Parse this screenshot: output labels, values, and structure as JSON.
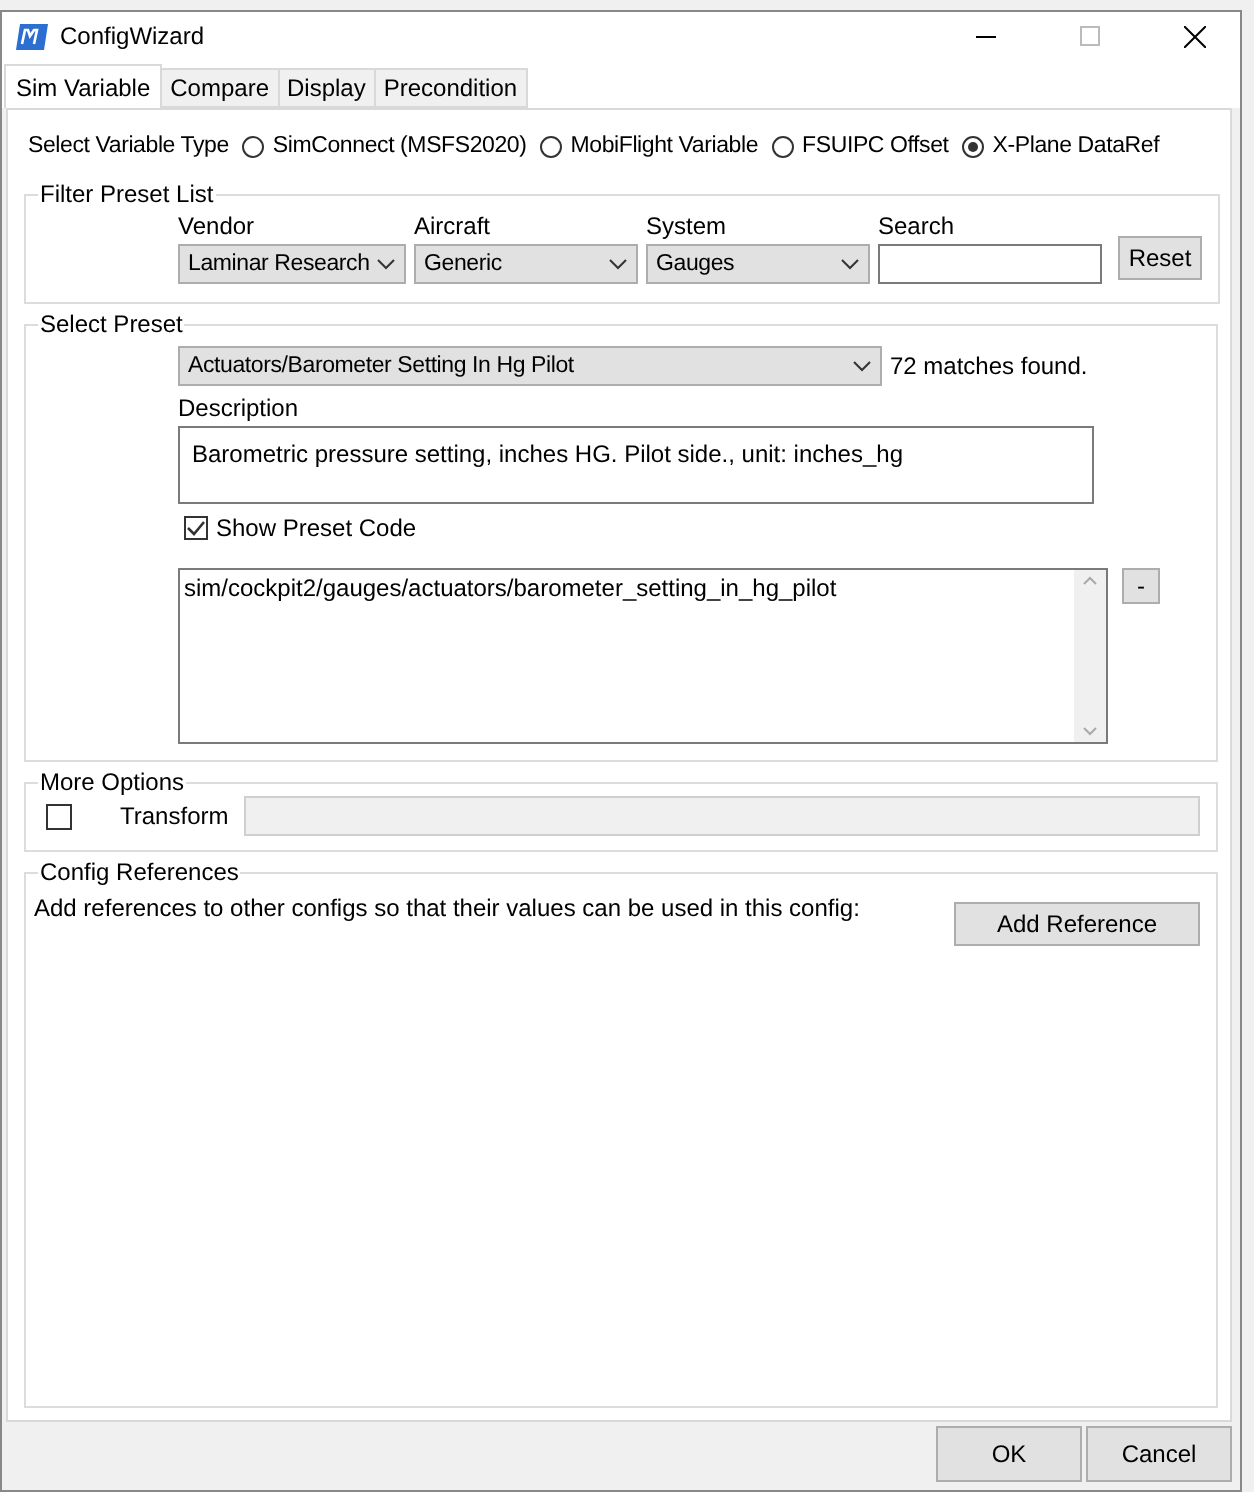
{
  "window": {
    "title": "ConfigWizard"
  },
  "tabs": [
    {
      "label": "Sim Variable",
      "selected": true
    },
    {
      "label": "Compare",
      "selected": false
    },
    {
      "label": "Display",
      "selected": false
    },
    {
      "label": "Precondition",
      "selected": false
    }
  ],
  "variable_type": {
    "label": "Select Variable Type",
    "options": [
      {
        "label": "SimConnect (MSFS2020)",
        "selected": false
      },
      {
        "label": "MobiFlight Variable",
        "selected": false
      },
      {
        "label": "FSUIPC Offset",
        "selected": false
      },
      {
        "label": "X-Plane DataRef",
        "selected": true
      }
    ]
  },
  "filter": {
    "title": "Filter Preset List",
    "dropdowns": [
      {
        "label": "Vendor",
        "value": "Laminar Research"
      },
      {
        "label": "Aircraft",
        "value": "Generic"
      },
      {
        "label": "System",
        "value": "Gauges"
      }
    ],
    "search": {
      "label": "Search"
    },
    "reset_button": "Reset"
  },
  "preset": {
    "title": "Select Preset",
    "value": "Actuators/Barometer Setting In Hg Pilot",
    "matches": "72 matches found.",
    "description_label": "Description",
    "description": "Barometric pressure setting, inches HG.  Pilot side., unit: inches_hg",
    "show_code": {
      "label": "Show Preset Code",
      "checked": true
    },
    "code": "sim/cockpit2/gauges/actuators/barometer_setting_in_hg_pilot",
    "collapse_button": "-"
  },
  "more_options": {
    "title": "More Options",
    "transform": {
      "label": "Transform",
      "checked": false
    }
  },
  "config_references": {
    "title": "Config References",
    "text": "Add references to other configs so that their values can be used in this config:",
    "add_button": "Add Reference"
  },
  "buttons": [
    "OK",
    "Cancel"
  ]
}
